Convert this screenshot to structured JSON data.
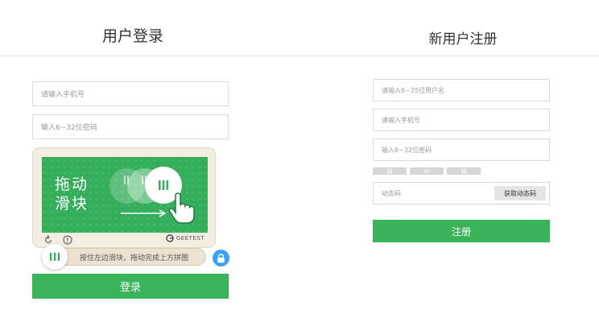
{
  "login": {
    "title": "用户登录",
    "phone_placeholder": "请输入手机号",
    "password_placeholder": "输入6~32位密码",
    "submit_label": "登录"
  },
  "captcha": {
    "image_text_line1": "拖动",
    "image_text_line2": "滑块",
    "slider_hint": "按住左边滑块，拖动完成上方拼图",
    "brand": "GEETEST",
    "refresh_icon": "refresh-icon",
    "info_icon": "info-icon",
    "lock_icon": "lock-icon",
    "background_color": "#34ae5b",
    "lock_color": "#36a3f3"
  },
  "register": {
    "title": "新用户注册",
    "username_placeholder": "请输入6~25位用户名",
    "phone_placeholder": "请输入手机号",
    "password_placeholder": "输入6~32位密码",
    "strength_levels": [
      "弱",
      "中",
      "强"
    ],
    "sms_code_placeholder": "动态码",
    "get_code_label": "获取动态码",
    "submit_label": "注册"
  },
  "colors": {
    "accent_green": "#3ab458"
  }
}
